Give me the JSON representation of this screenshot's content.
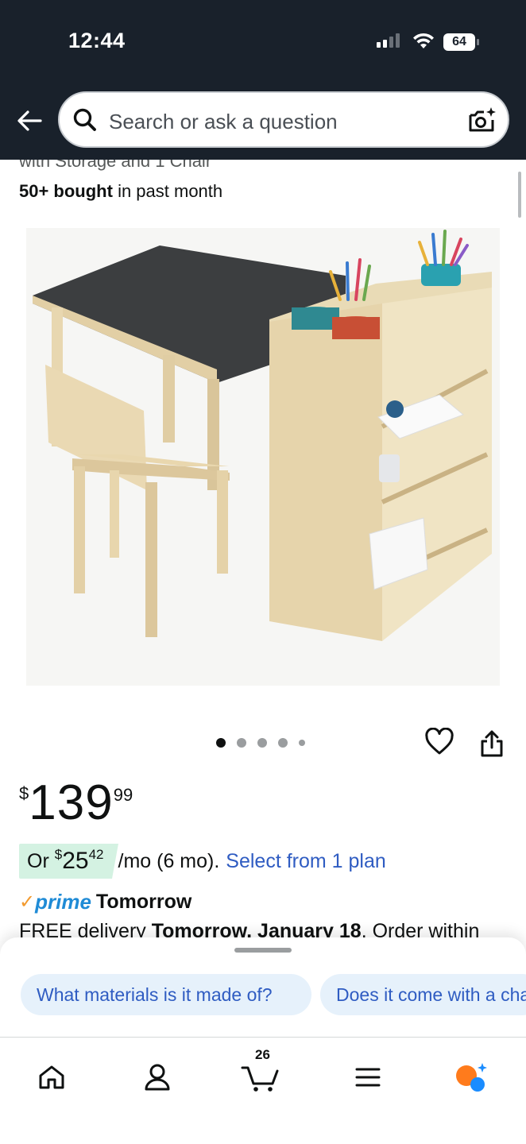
{
  "status_bar": {
    "time": "12:44",
    "battery": "64"
  },
  "search": {
    "placeholder": "Search or ask a question"
  },
  "product": {
    "title_cutoff": "with Storage and 1 Chair",
    "bought_bold": "50+ bought",
    "bought_rest": " in past month",
    "image_count": 5,
    "image_active_index": 0
  },
  "price": {
    "currency": "$",
    "whole": "139",
    "fraction": "99"
  },
  "installment": {
    "prefix": "Or ",
    "currency": "$",
    "whole": "25",
    "fraction": "42",
    "suffix": "/mo (6 mo).",
    "link": "Select from 1 plan"
  },
  "prime": {
    "check": "✓",
    "logo": "prime",
    "text": "Tomorrow"
  },
  "delivery": {
    "prefix": "FREE delivery ",
    "date": "Tomorrow, January 18",
    "suffix": ". Order within"
  },
  "suggestions": [
    {
      "label": "What materials is it made of?"
    },
    {
      "label": "Does it come with a chair?"
    }
  ],
  "tabbar": {
    "cart_count": "26"
  },
  "colors": {
    "header_bg": "#19212b",
    "link": "#2f5cc2",
    "prime_blue": "#1f8bd6",
    "chip_bg": "#e6f1fb",
    "installment_bg": "#d4f2e2"
  }
}
